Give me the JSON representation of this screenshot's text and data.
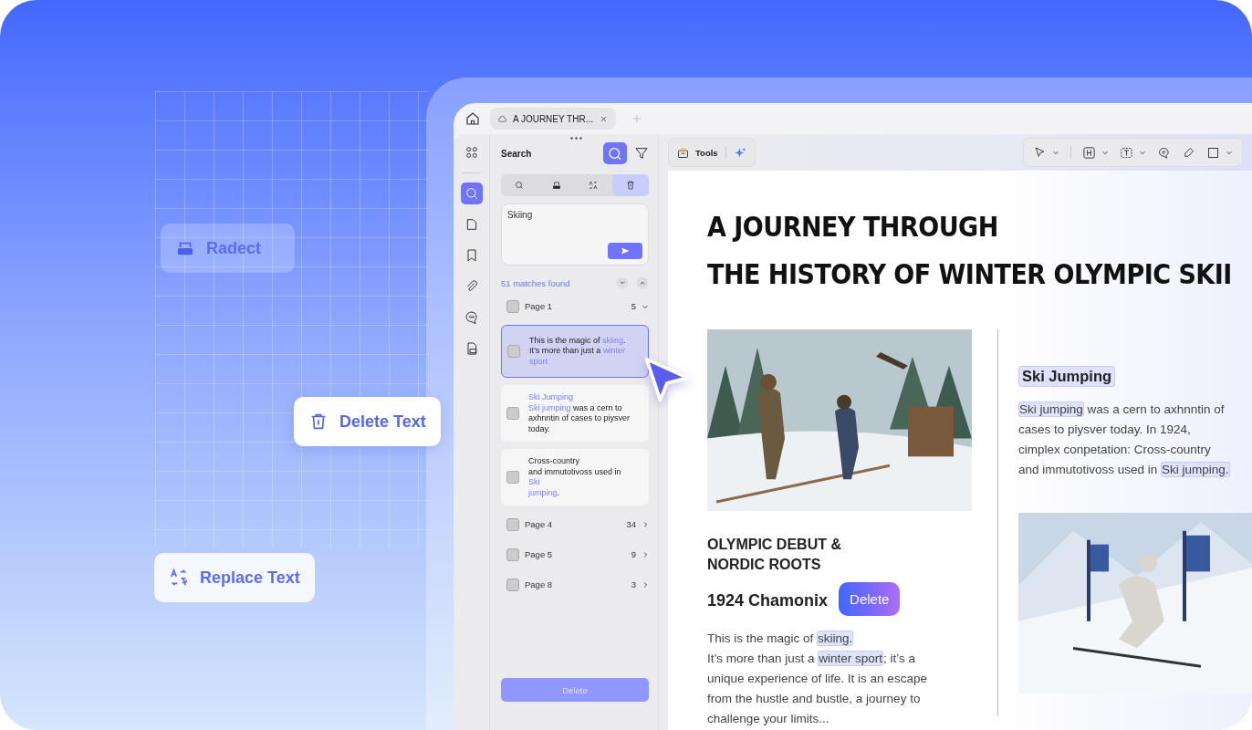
{
  "badges": [
    {
      "kind": "redact",
      "label": "Radect"
    },
    {
      "kind": "delete",
      "label": "Delete Text"
    },
    {
      "kind": "replace",
      "label": "Replace Text"
    }
  ],
  "window": {
    "tabs": [
      {
        "title": "A JOURNEY THR...",
        "selected": true
      }
    ]
  },
  "sidebar": {
    "items": [
      {
        "kind": "apps",
        "selected": false
      },
      {
        "kind": "search",
        "selected": true
      },
      {
        "kind": "page",
        "selected": false
      },
      {
        "kind": "bookmark",
        "selected": false
      },
      {
        "kind": "attachment",
        "selected": false
      },
      {
        "kind": "comment",
        "selected": false
      },
      {
        "kind": "form",
        "selected": false
      }
    ]
  },
  "search_panel": {
    "title": "Search",
    "modes": [
      {
        "kind": "search",
        "selected": false
      },
      {
        "kind": "redact",
        "selected": false
      },
      {
        "kind": "replace",
        "selected": false
      },
      {
        "kind": "delete",
        "selected": true
      }
    ],
    "query": "Skiing",
    "matches": "51  matches found",
    "groups": [
      {
        "page": "Page 1",
        "count": "5",
        "expanded": true,
        "checked": false,
        "results": [
          {
            "selected": true,
            "checked": false,
            "lines": [
              [
                {
                  "t": "This is the magic of "
                },
                {
                  "t": "skiing",
                  "match": true
                },
                {
                  "t": "."
                }
              ],
              [
                {
                  "t": "It’s more than just a "
                },
                {
                  "t": "winter sport",
                  "match": true
                }
              ]
            ]
          },
          {
            "selected": false,
            "checked": false,
            "lines": [
              [
                {
                  "t": "Ski Jumping",
                  "match": true
                }
              ],
              [
                {
                  "t": "Ski jumping",
                  "match": true
                },
                {
                  "t": " was a cern to axhnntin of cases to piysver today."
                }
              ]
            ]
          },
          {
            "selected": false,
            "checked": false,
            "lines": [
              [
                {
                  "t": "Cross-country"
                }
              ],
              [
                {
                  "t": "and immutotivoss used in"
                }
              ],
              [
                {
                  "t": "Ski",
                  "match": true
                }
              ],
              [
                {
                  "t": "jumping",
                  "match": true
                },
                {
                  "t": "."
                }
              ]
            ]
          }
        ]
      },
      {
        "page": "Page 4",
        "count": "34",
        "expanded": false,
        "checked": false
      },
      {
        "page": "Page 5",
        "count": "9",
        "expanded": false,
        "checked": false
      },
      {
        "page": "Page 8",
        "count": "3",
        "expanded": false,
        "checked": false
      }
    ],
    "delete_button": {
      "label": "Delete",
      "disabled": true
    }
  },
  "toolbar": {
    "tools_label": "Tools"
  },
  "document": {
    "title": [
      "A JOURNEY THROUGH",
      "THE HISTORY OF WINTER OLYMPIC SKII"
    ],
    "left": {
      "heading": [
        "OLYMPIC DEBUT &",
        "NORDIC ROOTS"
      ],
      "subheading": "1924 Chamonix",
      "tooltip": "Delete",
      "lines": [
        [
          {
            "t": "This is the magic of "
          },
          {
            "t": "skiing.",
            "match": true
          }
        ],
        [
          {
            "t": "It’s more than just a "
          },
          {
            "t": "winter sport",
            "match": true
          },
          {
            "t": "; it’s a unique experience of life. It is an escape from the hustle and bustle, a journey to challenge your limits..."
          }
        ]
      ]
    },
    "right": {
      "heading": {
        "t": "Ski Jumping",
        "match": true
      },
      "lines": [
        [
          {
            "t": "Ski jumping",
            "match": true
          },
          {
            "t": " was a cern to axhnntin of cases to piysver today. In 1924, cimplex conpetation: Cross-country and immutotivoss used in "
          },
          {
            "t": "Ski jumping.",
            "match": true
          }
        ]
      ]
    }
  }
}
